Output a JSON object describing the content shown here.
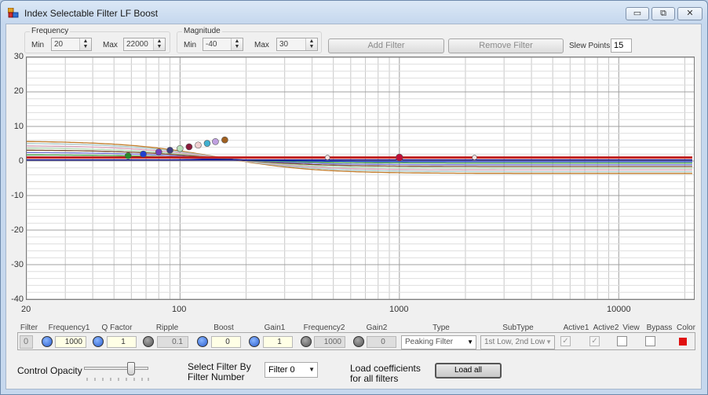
{
  "window": {
    "title": "Index Selectable Filter LF Boost",
    "min_glyph": "▭",
    "max_glyph": "⧉",
    "close_glyph": "✕"
  },
  "frequency": {
    "legend": "Frequency",
    "min_label": "Min",
    "min_value": "20",
    "max_label": "Max",
    "max_value": "22000"
  },
  "magnitude": {
    "legend": "Magnitude",
    "min_label": "Min",
    "min_value": "-40",
    "max_label": "Max",
    "max_value": "30"
  },
  "toolbar": {
    "add_filter": "Add Filter",
    "remove_filter": "Remove Filter",
    "slew_points_label": "Slew Points",
    "slew_points_value": "15"
  },
  "chart_data": {
    "type": "line",
    "x_scale": "log",
    "xlim": [
      20,
      22000
    ],
    "ylim": [
      -40,
      30
    ],
    "y_ticks": [
      "30",
      "20",
      "10",
      "0",
      "-10",
      "-20",
      "-30",
      "-40"
    ],
    "x_ticks": [
      "20",
      "100",
      "1000",
      "10000"
    ],
    "grid": true,
    "series": [
      {
        "color": "#c07a28",
        "low": 5.8,
        "high": -3.6,
        "fc": 150
      },
      {
        "color": "#a8c8c8",
        "low": 5.2,
        "high": -3.1,
        "fc": 150
      },
      {
        "color": "#d8a0b8",
        "low": 4.5,
        "high": -2.6,
        "fc": 150
      },
      {
        "color": "#b0d8b0",
        "low": 3.8,
        "high": -2.1,
        "fc": 150
      },
      {
        "color": "#7a4a2a",
        "low": 3.2,
        "high": -1.6,
        "fc": 150
      },
      {
        "color": "#7070d0",
        "low": 2.5,
        "high": -1.1,
        "fc": 150
      },
      {
        "color": "#40a040",
        "low": 1.8,
        "high": -0.6,
        "fc": 150
      },
      {
        "color": "#2040d0",
        "low": 1.2,
        "high": -0.2,
        "fc": 150
      },
      {
        "color": "#c02020",
        "low": 1.0,
        "high": 1.0,
        "fc": 150
      },
      {
        "color": "#000080",
        "low": 0.3,
        "high": 0.3,
        "fc": 150
      }
    ],
    "points": [
      {
        "x": 58,
        "y": 1.5,
        "color": "#2a8a2a"
      },
      {
        "x": 68,
        "y": 2.0,
        "color": "#2040d0"
      },
      {
        "x": 80,
        "y": 2.6,
        "color": "#7040c0"
      },
      {
        "x": 90,
        "y": 3.1,
        "color": "#404080"
      },
      {
        "x": 100,
        "y": 3.6,
        "color": "#b8e0b8"
      },
      {
        "x": 110,
        "y": 4.1,
        "color": "#8a1a3a"
      },
      {
        "x": 121,
        "y": 4.6,
        "color": "#f0d0d0"
      },
      {
        "x": 133,
        "y": 5.1,
        "color": "#40b0d0"
      },
      {
        "x": 145,
        "y": 5.6,
        "color": "#c0a0e0"
      },
      {
        "x": 160,
        "y": 6.1,
        "color": "#a06020"
      },
      {
        "x": 470,
        "y": 1.0,
        "color": "#f8e0e0"
      },
      {
        "x": 1000,
        "y": 1.0,
        "color": "#c0103a"
      },
      {
        "x": 2200,
        "y": 1.0,
        "color": "#f8e0e0"
      }
    ]
  },
  "table": {
    "headers": [
      "Filter",
      "Frequency1",
      "Q Factor",
      "Ripple",
      "Boost",
      "Gain1",
      "Frequency2",
      "Gain2",
      "Type",
      "SubType",
      "Active1",
      "Active2",
      "View",
      "Bypass",
      "Color"
    ],
    "filter_index": "0",
    "frequency1": "1000",
    "q_factor": "1",
    "ripple": "0.1",
    "boost": "0",
    "gain1": "1",
    "frequency2": "1000",
    "gain2": "0",
    "type": "Peaking Filter",
    "subtype": "1st Low, 2nd Low",
    "active1_mark": "✓",
    "active2_mark": "✓",
    "color": "#e01010"
  },
  "bottom": {
    "control_opacity": "Control Opacity",
    "opacity_level": 0.75,
    "select_filter_line1": "Select Filter By",
    "select_filter_line2": "Filter Number",
    "filter_select": "Filter 0",
    "load_line1": "Load coefficients",
    "load_line2": "for all filters",
    "load_all": "Load all"
  }
}
